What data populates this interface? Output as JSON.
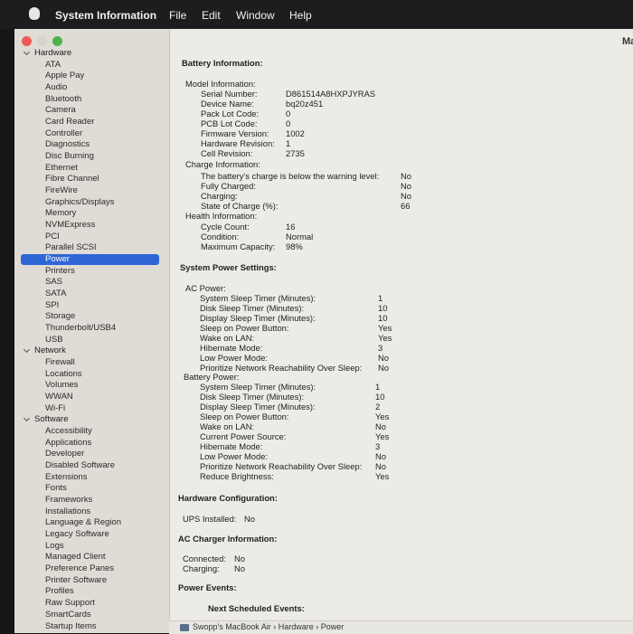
{
  "menubar": {
    "app": "System Information",
    "file": "File",
    "edit": "Edit",
    "window": "Window",
    "help": "Help"
  },
  "window": {
    "title_fragment": "Ma"
  },
  "colors": {
    "close": "#ee5b56",
    "minimize": "#d4d2cd",
    "zoom": "#4fb24a",
    "selection": "#2f66d6"
  },
  "sidebar": {
    "hardware": "Hardware",
    "hardware_items": [
      "ATA",
      "Apple Pay",
      "Audio",
      "Bluetooth",
      "Camera",
      "Card Reader",
      "Controller",
      "Diagnostics",
      "Disc Burning",
      "Ethernet",
      "Fibre Channel",
      "FireWire",
      "Graphics/Displays",
      "Memory",
      "NVMExpress",
      "PCI",
      "Parallel SCSI",
      "Power",
      "Printers",
      "SAS",
      "SATA",
      "SPI",
      "Storage",
      "Thunderbolt/USB4",
      "USB"
    ],
    "network": "Network",
    "network_items": [
      "Firewall",
      "Locations",
      "Volumes",
      "WWAN",
      "Wi-Fi"
    ],
    "software": "Software",
    "software_items": [
      "Accessibility",
      "Applications",
      "Developer",
      "Disabled Software",
      "Extensions",
      "Fonts",
      "Frameworks",
      "Installations",
      "Language & Region",
      "Legacy Software",
      "Logs",
      "Managed Client",
      "Preference Panes",
      "Printer Software",
      "Profiles",
      "Raw Support",
      "SmartCards",
      "Startup Items"
    ],
    "selected": "Power"
  },
  "content": {
    "battery_info": "Battery Information:",
    "model_info": "Model Information:",
    "serial_label": "Serial Number:",
    "serial_value": "D861514A8HXPJYRAS",
    "device_label": "Device Name:",
    "device_value": "bq20z451",
    "pack_label": "Pack Lot Code:",
    "pack_value": "0",
    "pcb_label": "PCB Lot Code:",
    "pcb_value": "0",
    "fw_label": "Firmware Version:",
    "fw_value": "1002",
    "hw_label": "Hardware Revision:",
    "hw_value": "1",
    "cell_label": "Cell Revision:",
    "cell_value": "2735",
    "charge_info": "Charge Information:",
    "below_label": "The battery's charge is below the warning level:",
    "below_value": "No",
    "full_label": "Fully Charged:",
    "full_value": "No",
    "charging_label": "Charging:",
    "charging_value": "No",
    "soc_label": "State of Charge (%):",
    "soc_value": "66",
    "health_info": "Health Information:",
    "cycle_label": "Cycle Count:",
    "cycle_value": "16",
    "cond_label": "Condition:",
    "cond_value": "Normal",
    "maxcap_label": "Maximum Capacity:",
    "maxcap_value": "98%",
    "sys_power": "System Power Settings:",
    "ac_power": "AC Power:",
    "ac_rows": [
      {
        "label": "System Sleep Timer (Minutes):",
        "value": "1"
      },
      {
        "label": "Disk Sleep Timer (Minutes):",
        "value": "10"
      },
      {
        "label": "Display Sleep Timer (Minutes):",
        "value": "10"
      },
      {
        "label": "Sleep on Power Button:",
        "value": "Yes"
      },
      {
        "label": "Wake on LAN:",
        "value": "Yes"
      },
      {
        "label": "Hibernate Mode:",
        "value": "3"
      },
      {
        "label": "Low Power Mode:",
        "value": "No"
      },
      {
        "label": "Prioritize Network Reachability Over Sleep:",
        "value": "No"
      }
    ],
    "battery_power": "Battery Power:",
    "bat_rows": [
      {
        "label": "System Sleep Timer (Minutes):",
        "value": "1"
      },
      {
        "label": "Disk Sleep Timer (Minutes):",
        "value": "10"
      },
      {
        "label": "Display Sleep Timer (Minutes):",
        "value": "2"
      },
      {
        "label": "Sleep on Power Button:",
        "value": "Yes"
      },
      {
        "label": "Wake on LAN:",
        "value": "No"
      },
      {
        "label": "Current Power Source:",
        "value": "Yes"
      },
      {
        "label": "Hibernate Mode:",
        "value": "3"
      },
      {
        "label": "Low Power Mode:",
        "value": "No"
      },
      {
        "label": "Prioritize Network Reachability Over Sleep:",
        "value": "No"
      },
      {
        "label": "Reduce Brightness:",
        "value": "Yes"
      }
    ],
    "hw_config": "Hardware Configuration:",
    "ups_label": "UPS Installed:",
    "ups_value": "No",
    "ac_charger": "AC Charger Information:",
    "connected_label": "Connected:",
    "connected_value": "No",
    "charger_charging_label": "Charging:",
    "charger_charging_value": "No",
    "power_events": "Power Events:",
    "next_events": "Next Scheduled Events:"
  },
  "pathbar": {
    "text": "Swopp's MacBook Air › Hardware › Power"
  }
}
